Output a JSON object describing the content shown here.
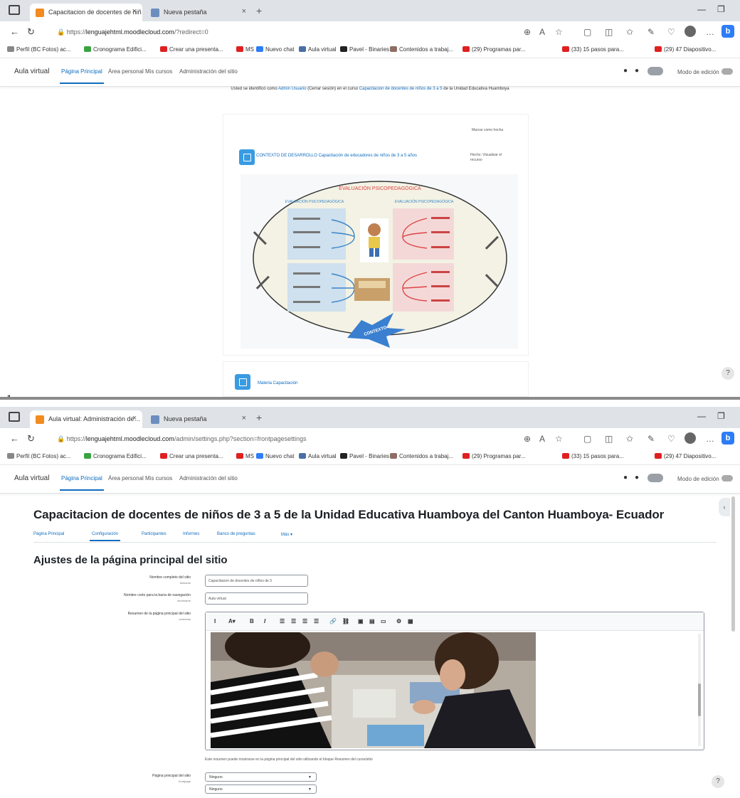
{
  "screen1": {
    "tabs": [
      {
        "title": "Capacitacion de docentes de niñ…",
        "active": true
      },
      {
        "title": "Nueva pestaña",
        "active": false
      }
    ],
    "url": {
      "prefix": "https://",
      "host": "lenguajehtml.moodlecloud.com",
      "path": "/?redirect=0"
    },
    "bookmarks": [
      "Perfil (BC Fotos) ac...",
      "Cronograma Edifici...",
      "Crear una presenta...",
      "MS",
      "Nuevo chat",
      "Aula virtual",
      "Pavel - Binaries",
      "Contenidos a trabaj...",
      "(29) Programas par...",
      "(33) 15 pasos para...",
      "(29) 47 Diapositivo..."
    ],
    "site_name": "Aula virtual",
    "nav": [
      "Página Principal",
      "Área personal",
      "Mis cursos",
      "Administración del sitio"
    ],
    "edit_mode": "Modo de edición",
    "notice": {
      "before": "Usted se identificó como ",
      "user": "Admin Usuario",
      "middle": " (Cerrar sesión) en el curso ",
      "course": "Capacitacion de docentes de niños de 3 a 5",
      "after": " de la Unidad Educativa Huamboya"
    },
    "mark_done": "Marcar como hecha",
    "activity_title": "CONTEXTO DE DESARROLLO Capacitación de educadores de niños de 3 a 5 años",
    "activity_meta": "Hecho: Visualizar el recurso",
    "figure": {
      "title": "EVALUACIÓN PSICOPEDAGÓGICA",
      "left_head": "EVALUACIÓN PSICOPEDAGÓGICA",
      "right_head": "EVALUACIÓN PSICOPEDAGÓGICA",
      "badge": "CONTEXTO"
    },
    "activity2_label": "Materia Capacitación"
  },
  "screen2": {
    "tabs": [
      {
        "title": "Aula virtual: Administración de…",
        "active": true
      },
      {
        "title": "Nueva pestaña",
        "active": false
      }
    ],
    "url": {
      "prefix": "https://",
      "host": "lenguajehtml.moodlecloud.com",
      "path": "/admin/settings.php?section=frontpagesettings"
    },
    "site_name": "Aula virtual",
    "nav": [
      "Página Principal",
      "Área personal",
      "Mis cursos",
      "Administración del sitio"
    ],
    "edit_mode": "Modo de edición",
    "course_title": "Capacitacion de docentes de niños de 3 a 5 de la Unidad Educativa Huamboya del Canton Huamboya- Ecuador",
    "subtabs": [
      "Página Principal",
      "Configuración",
      "Participantes",
      "Informes",
      "Banco de preguntas",
      "Más"
    ],
    "page_heading": "Ajustes de la página principal del sitio",
    "fields": {
      "fullname": {
        "label": "Nombre completo del sitio",
        "key": "fullname",
        "value": "Capacitacion de docentes de niños de 3"
      },
      "shortname": {
        "label": "Nombre corto para la barra de navegación",
        "key": "shortname",
        "value": "Aula virtual"
      },
      "summary": {
        "label": "Resumen de la página principal del sitio",
        "key": "summary"
      },
      "frontpage": {
        "label": "Página principal del sitio",
        "key": "frontpage"
      }
    },
    "toolbar": [
      "I",
      "A▾",
      "B",
      "I",
      "☰",
      "☰",
      "☰",
      "☰",
      "🔗",
      "⛓",
      "▣",
      "▤",
      "▭",
      "⚙",
      "▦"
    ],
    "help_text": "Este resumen puede mostrarse en la página principal del sitio utilizando el bloque Resumen del curso/sitio",
    "frontpage_selects": [
      "Ninguno",
      "Ninguno"
    ]
  }
}
